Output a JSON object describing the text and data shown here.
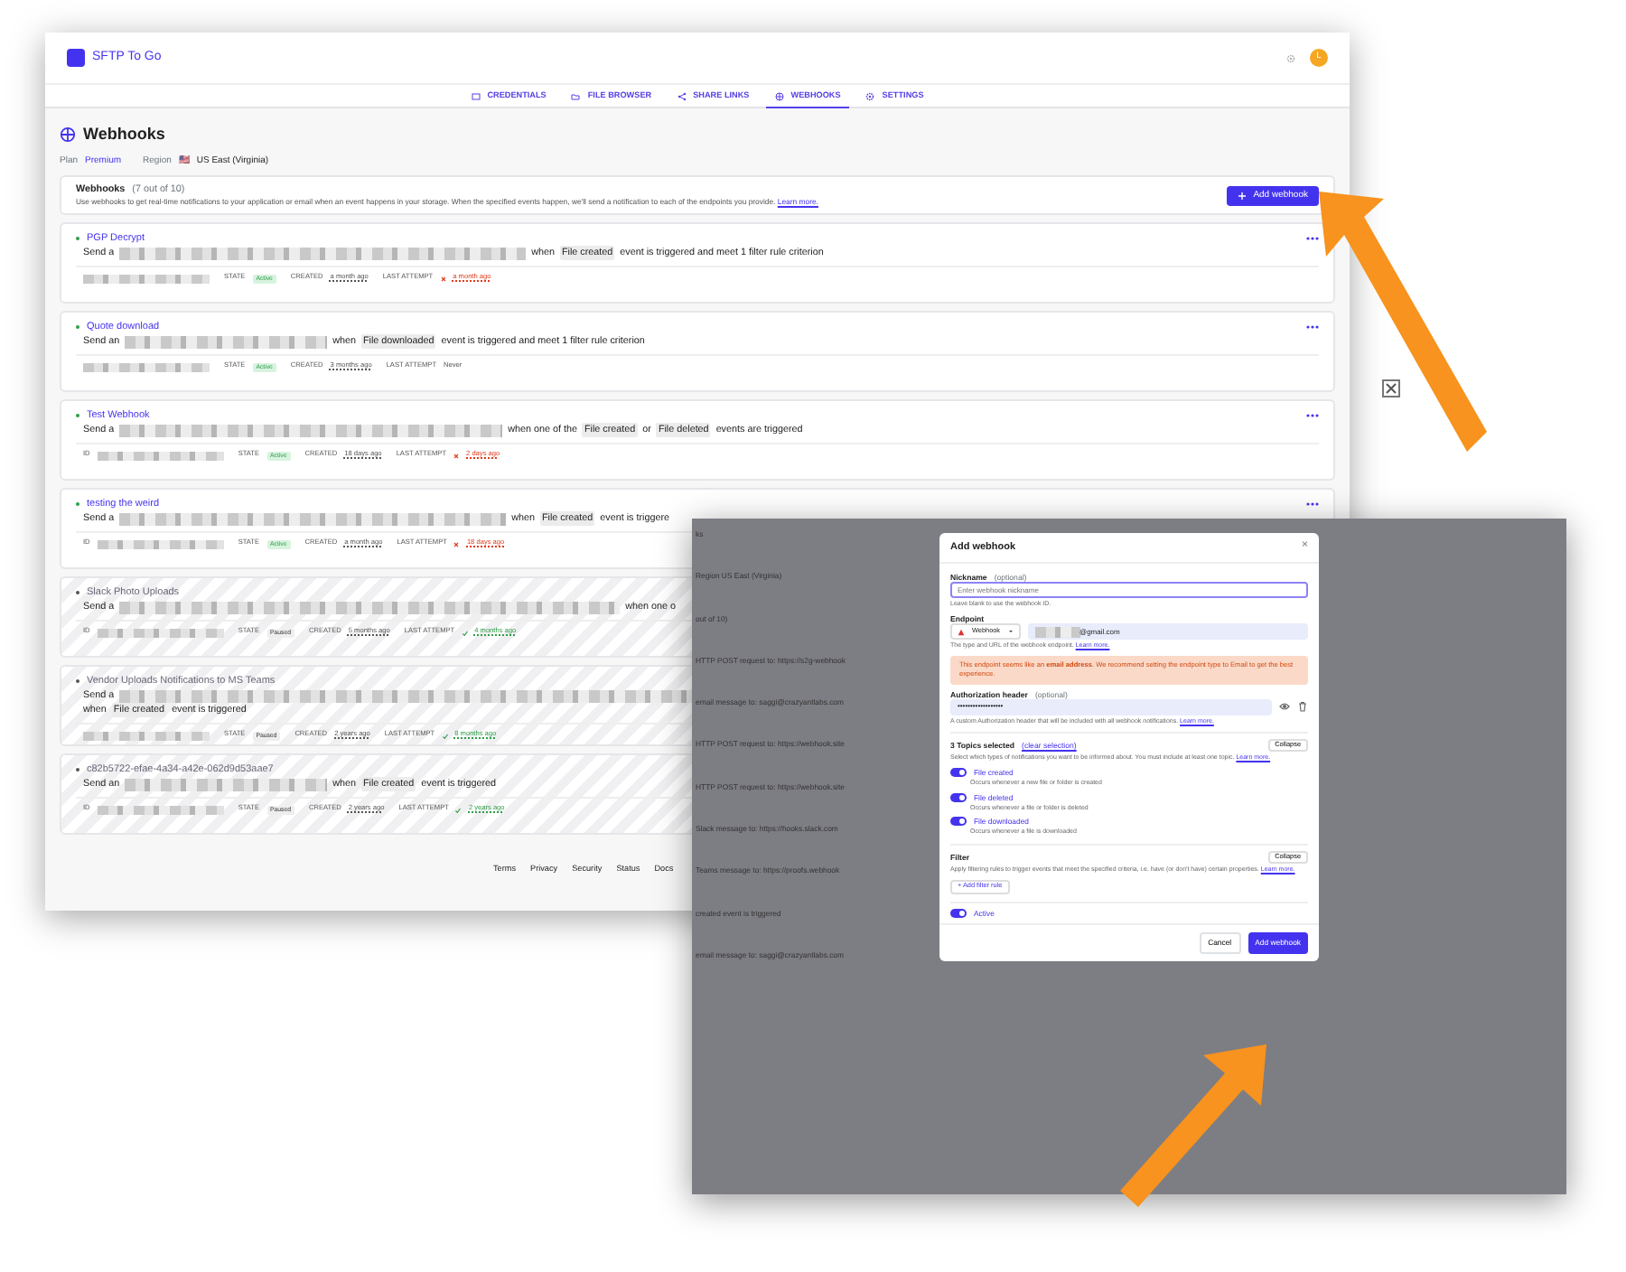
{
  "app": {
    "name": "SFTP To Go",
    "avatar": "L"
  },
  "nav_tabs": [
    {
      "label": "CREDENTIALS",
      "selected": false
    },
    {
      "label": "FILE BROWSER",
      "selected": false
    },
    {
      "label": "SHARE LINKS",
      "selected": false
    },
    {
      "label": "WEBHOOKS",
      "selected": true
    },
    {
      "label": "SETTINGS",
      "selected": false
    }
  ],
  "page": {
    "title": "Webhooks",
    "plan_label": "Plan",
    "plan": "Premium",
    "region_label": "Region",
    "region_flag": "🇺🇸",
    "region": "US East (Virginia)"
  },
  "panel": {
    "title": "Webhooks",
    "count": "(7 out of 10)",
    "description": "Use webhooks to get real-time notifications to your application or email when an event happens in your storage. When the specified events happen, we'll send a notification to each of the endpoints you provide.",
    "learn_more": "Learn more.",
    "add_button": "Add webhook"
  },
  "webhooks": [
    {
      "name": "PGP Decrypt",
      "paused": false,
      "send": "Send a",
      "parts": [
        {
          "kind": "text",
          "text": "when"
        },
        {
          "kind": "tag",
          "text": "File created"
        },
        {
          "kind": "text",
          "text": "event is triggered and meet 1 filter rule criterion"
        }
      ],
      "state_label": "STATE",
      "state": "Active",
      "created_label": "CREATED",
      "created": "a month ago",
      "last_attempt_label": "LAST ATTEMPT",
      "last_attempt": "a month ago",
      "failed": true,
      "succeeded": false
    },
    {
      "name": "Quote download",
      "paused": false,
      "send": "Send an",
      "parts": [
        {
          "kind": "text",
          "text": "when"
        },
        {
          "kind": "tag",
          "text": "File downloaded"
        },
        {
          "kind": "text",
          "text": "event is triggered and meet 1 filter rule criterion"
        }
      ],
      "state_label": "STATE",
      "state": "Active",
      "created_label": "CREATED",
      "created": "3 months ago",
      "last_attempt_label": "LAST ATTEMPT",
      "last_attempt": "Never",
      "failed": false,
      "succeeded": false
    },
    {
      "name": "Test Webhook",
      "paused": false,
      "send": "Send a",
      "parts": [
        {
          "kind": "text",
          "text": "when one of the"
        },
        {
          "kind": "tag",
          "text": "File created"
        },
        {
          "kind": "text",
          "text": "or"
        },
        {
          "kind": "tag",
          "text": "File deleted"
        },
        {
          "kind": "text",
          "text": "events are triggered"
        }
      ],
      "id_label": "ID",
      "state_label": "STATE",
      "state": "Active",
      "created_label": "CREATED",
      "created": "18 days ago",
      "last_attempt_label": "LAST ATTEMPT",
      "last_attempt": "2 days ago",
      "failed": true,
      "succeeded": false
    },
    {
      "name": "testing the weird",
      "paused": false,
      "send": "Send a",
      "parts": [
        {
          "kind": "text",
          "text": "when"
        },
        {
          "kind": "tag",
          "text": "File created"
        },
        {
          "kind": "text",
          "text": "event is triggere"
        }
      ],
      "id_label": "ID",
      "state_label": "STATE",
      "state": "Active",
      "created_label": "CREATED",
      "created": "a month ago",
      "last_attempt_label": "LAST ATTEMPT",
      "last_attempt": "18 days ago",
      "failed": true,
      "succeeded": false
    },
    {
      "name": "Slack Photo Uploads",
      "paused": true,
      "send": "Send a",
      "parts": [
        {
          "kind": "text",
          "text": "when one o"
        }
      ],
      "id_label": "ID",
      "state_label": "STATE",
      "state": "Paused",
      "created_label": "CREATED",
      "created": "5 months ago",
      "last_attempt_label": "LAST ATTEMPT",
      "last_attempt": "4 months ago",
      "failed": false,
      "succeeded": true
    },
    {
      "name": "Vendor Uploads Notifications to MS Teams",
      "paused": true,
      "send": "Send a",
      "parts": [
        {
          "kind": "text",
          "text": "when"
        },
        {
          "kind": "tag",
          "text": "File created"
        },
        {
          "kind": "text",
          "text": "event is triggered"
        }
      ],
      "state_label": "STATE",
      "state": "Paused",
      "created_label": "CREATED",
      "created": "2 years ago",
      "last_attempt_label": "LAST ATTEMPT",
      "last_attempt": "8 months ago",
      "failed": false,
      "succeeded": true
    },
    {
      "name": "c82b5722-efae-4a34-a42e-062d9d53aae7",
      "paused": true,
      "send": "Send an",
      "parts": [
        {
          "kind": "text",
          "text": "when"
        },
        {
          "kind": "tag",
          "text": "File created"
        },
        {
          "kind": "text",
          "text": "event is triggered"
        }
      ],
      "id_label": "ID",
      "state_label": "STATE",
      "state": "Paused",
      "created_label": "CREATED",
      "created": "2 years ago",
      "last_attempt_label": "LAST ATTEMPT",
      "last_attempt": "2 years ago",
      "failed": false,
      "succeeded": true
    }
  ],
  "footer": [
    "Terms",
    "Privacy",
    "Security",
    "Status",
    "Docs"
  ],
  "backdrop_lines": [
    "ks",
    "Region  US East (Virginia)",
    "out of 10)",
    "HTTP POST request to: https://s2g-webhook",
    "email message to: saggi@crazyantlabs.com",
    "HTTP POST request to: https://webhook.site",
    "HTTP POST request to: https://webhook.site",
    "Slack message to: https://hooks.slack.com",
    "Teams message to: https://proofs.webhook",
    "created event is triggered",
    "email message to: saggi@crazyantlabs.com"
  ],
  "modal": {
    "title": "Add webhook",
    "close": "×",
    "nickname": {
      "label": "Nickname",
      "optional": "(optional)",
      "placeholder": "Enter webhook nickname",
      "help": "Leave blank to use the webhook ID."
    },
    "endpoint": {
      "label": "Endpoint",
      "type": "Webhook",
      "value": "@gmail.com",
      "help": "The type and URL of the webhook endpoint.",
      "learn_more": "Learn more."
    },
    "alert": "This endpoint seems like an **email address**. We recommend setting the endpoint type to Email to get the best experience.",
    "auth": {
      "label": "Authorization header",
      "optional": "(optional)",
      "value": "••••••••••••••••••",
      "help": "A custom Authorization header that will be included with all webhook notifications.",
      "learn_more": "Learn more."
    },
    "topics": {
      "title": "3 Topics selected",
      "clear": "(clear selection)",
      "collapse": "Collapse",
      "help": "Select which types of notifications you want to be informed about. You must include at least one topic.",
      "learn_more": "Learn more.",
      "items": [
        {
          "label": "File created",
          "desc": "Occurs whenever a new file or folder is created",
          "on": true
        },
        {
          "label": "File deleted",
          "desc": "Occurs whenever a file or folder is deleted",
          "on": true
        },
        {
          "label": "File downloaded",
          "desc": "Occurs whenever a file is downloaded",
          "on": true
        }
      ]
    },
    "filter": {
      "title": "Filter",
      "collapse": "Collapse",
      "help": "Apply filtering rules to trigger events that meet the specified criteria, i.e. have (or don't have) certain properties.",
      "learn_more": "Learn more.",
      "add_rule": "+ Add filter rule"
    },
    "active": {
      "label": "Active",
      "on": true
    },
    "cancel": "Cancel",
    "submit": "Add webhook"
  }
}
